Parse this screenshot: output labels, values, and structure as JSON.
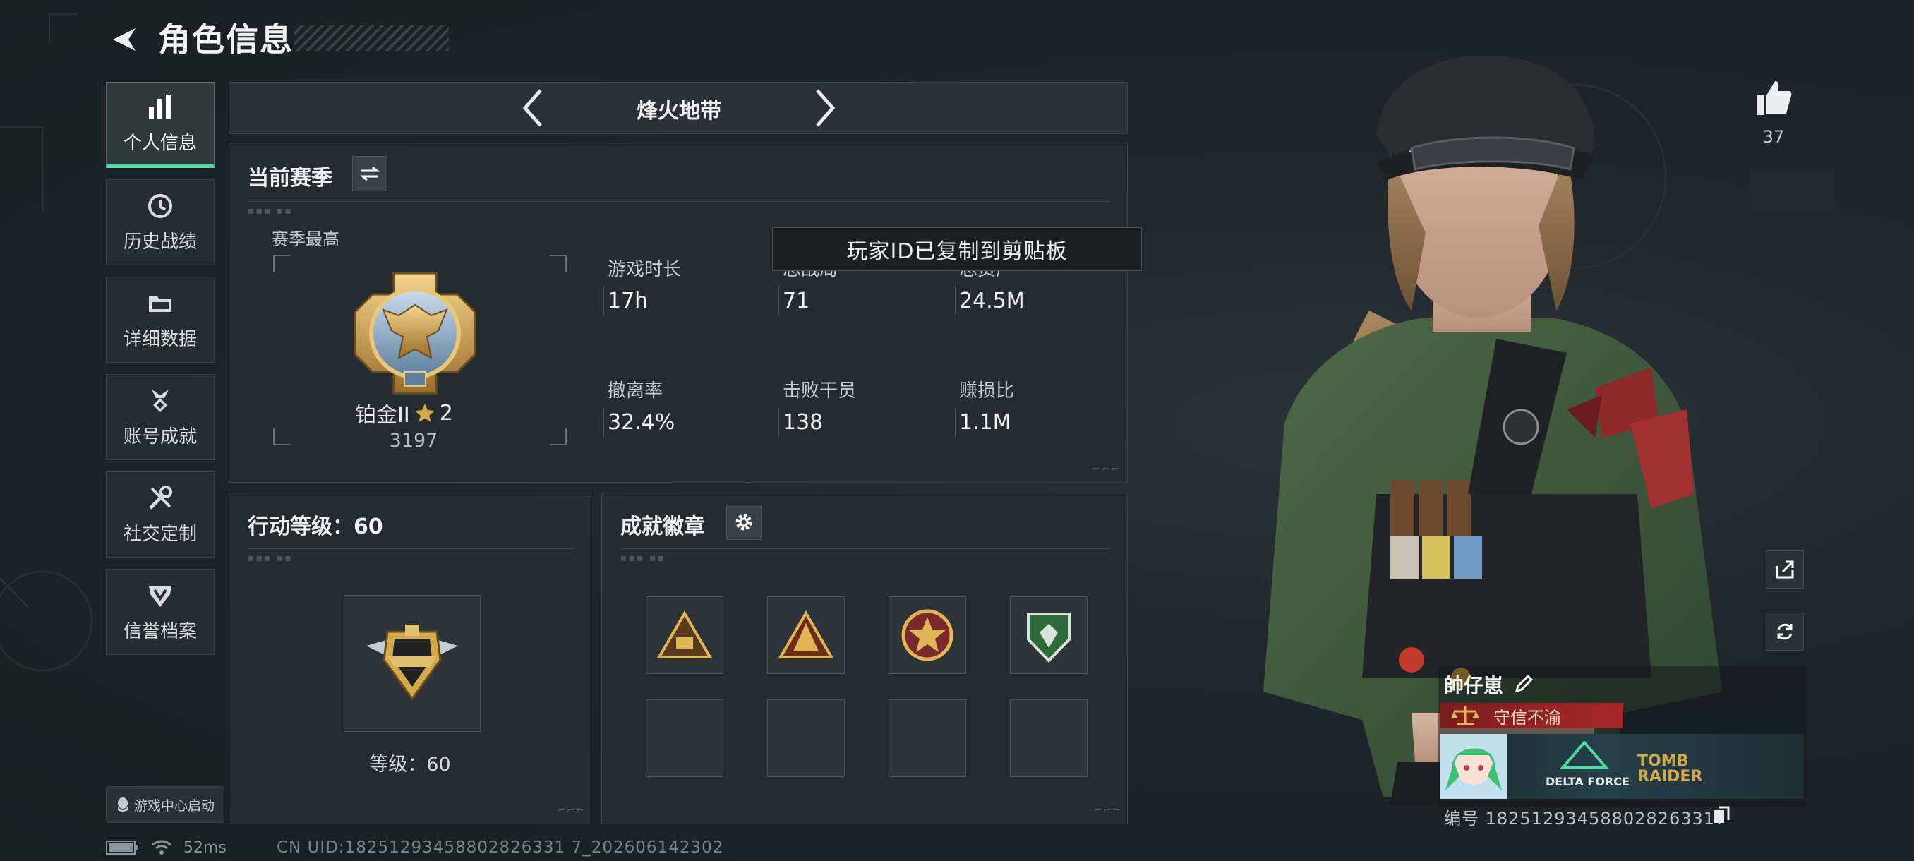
{
  "header": {
    "title": "角色信息"
  },
  "sidebar": {
    "items": [
      {
        "label": "个人信息",
        "active": true
      },
      {
        "label": "历史战绩",
        "active": false
      },
      {
        "label": "详细数据",
        "active": false
      },
      {
        "label": "账号成就",
        "active": false
      },
      {
        "label": "社交定制",
        "active": false
      },
      {
        "label": "信誉档案",
        "active": false
      }
    ],
    "game_center_label": "游戏中心启动"
  },
  "mode_selector": {
    "current": "烽火地带"
  },
  "season": {
    "title": "当前赛季",
    "best_label": "赛季最高",
    "rank_name": "铂金II",
    "rank_stars": "2",
    "rank_score": "3197",
    "stats": [
      {
        "label": "游戏时长",
        "value": "17h"
      },
      {
        "label": "总战局",
        "value": "71"
      },
      {
        "label": "总资产",
        "value": "24.5M"
      },
      {
        "label": "撤离率",
        "value": "32.4%"
      },
      {
        "label": "击败干员",
        "value": "138"
      },
      {
        "label": "赚损比",
        "value": "1.1M"
      }
    ]
  },
  "toast": {
    "text": "玩家ID已复制到剪贴板"
  },
  "level_panel": {
    "title": "行动等级：60",
    "level_text": "等级：60"
  },
  "achievement_panel": {
    "title": "成就徽章"
  },
  "profile": {
    "likes": "37",
    "player_name": "帥仔崽",
    "credit_tag": "守信不渝",
    "player_id": "编号 18251293458802826331‌7",
    "banner_text_1": "DELTA FORCE",
    "banner_text_2": "TOMB RAIDER"
  },
  "status_bar": {
    "ping": "52ms",
    "uid": "CN UID:18251293458802826331 7_202606142302"
  },
  "colors": {
    "accent": "#4fd8a2",
    "credit_red": "#a82828",
    "gold": "#d4a94a"
  }
}
